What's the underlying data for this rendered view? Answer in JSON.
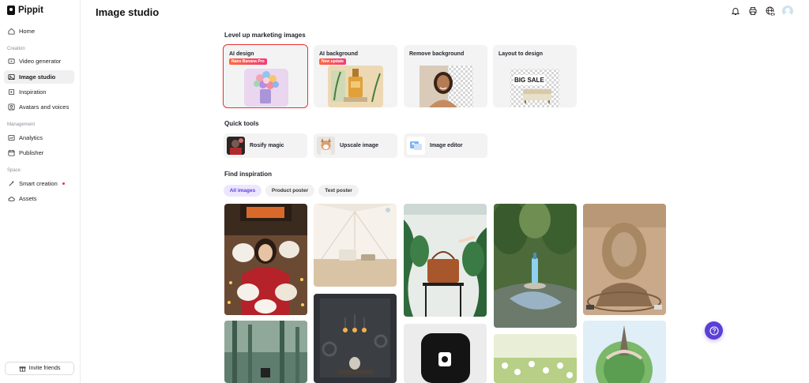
{
  "app": {
    "logo_text": "Pippit"
  },
  "header": {
    "title": "Image studio",
    "icons": [
      "bell-icon",
      "printer-icon",
      "globe-language-icon",
      "user-avatar"
    ]
  },
  "sidebar": {
    "home": "Home",
    "sections": {
      "creation": "Creation",
      "management": "Management",
      "space": "Space"
    },
    "creation_items": [
      {
        "label": "Video generator",
        "icon": "video-icon"
      },
      {
        "label": "Image studio",
        "icon": "image-icon",
        "active": true
      },
      {
        "label": "Inspiration",
        "icon": "lightbulb-icon"
      },
      {
        "label": "Avatars and voices",
        "icon": "avatar-icon"
      }
    ],
    "management_items": [
      {
        "label": "Analytics",
        "icon": "analytics-icon"
      },
      {
        "label": "Publisher",
        "icon": "calendar-icon"
      }
    ],
    "space_items": [
      {
        "label": "Smart creation",
        "icon": "sparkle-icon",
        "dot_color": "#f5313d"
      },
      {
        "label": "Assets",
        "icon": "cloud-icon"
      }
    ],
    "invite": "Invite friends"
  },
  "main": {
    "level_up_title": "Level up marketing images",
    "cards": [
      {
        "title": "AI design",
        "badge": "Nano Banana Pro"
      },
      {
        "title": "AI background",
        "badge": "New update"
      },
      {
        "title": "Remove background"
      },
      {
        "title": "Layout to design",
        "art_text": "BIG SALE"
      }
    ],
    "quick_tools_title": "Quick tools",
    "tools": [
      {
        "label": "Rosify magic"
      },
      {
        "label": "Upscale image"
      },
      {
        "label": "Image editor"
      }
    ],
    "inspiration_title": "Find inspiration",
    "chips": [
      {
        "label": "All images",
        "active": true
      },
      {
        "label": "Product poster"
      },
      {
        "label": "Text poster"
      }
    ]
  },
  "colors": {
    "accent": "#5b3fd6",
    "selection_outline": "#e5322e",
    "badge_gradient_start": "#ff6a3d",
    "badge_gradient_end": "#f03b7a"
  }
}
